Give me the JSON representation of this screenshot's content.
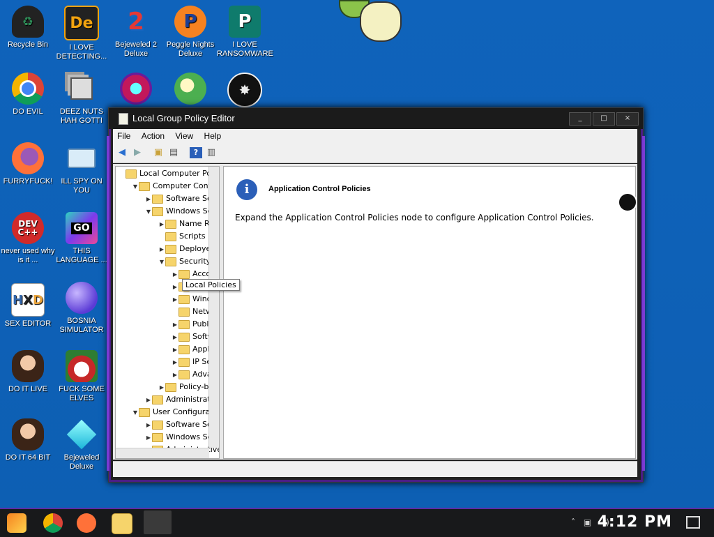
{
  "desktop_icons": [
    {
      "label": "Recycle Bin",
      "icon": "recycle-bin-icon"
    },
    {
      "label": "I LOVE DETECTING...",
      "icon": "detect-it-easy-icon"
    },
    {
      "label": "Bejeweled 2 Deluxe",
      "icon": "bejeweled-2-icon"
    },
    {
      "label": "Peggle Nights Deluxe",
      "icon": "peggle-icon"
    },
    {
      "label": "I LOVE RANSOMWARE",
      "icon": "publisher-icon"
    },
    {
      "label": "DO EVIL",
      "icon": "chrome-icon"
    },
    {
      "label": "DEEZ NUTS HAH GOTTI",
      "icon": "windows-stack-icon"
    },
    {
      "label": "",
      "icon": "gem-icon"
    },
    {
      "label": "",
      "icon": "plants-icon"
    },
    {
      "label": "",
      "icon": "dragon-icon"
    },
    {
      "label": "FURRYFUCK!",
      "icon": "firefox-icon"
    },
    {
      "label": "ILL SPY ON YOU",
      "icon": "spy-icon"
    },
    {
      "label": "never used why is it ...",
      "icon": "devcpp-icon"
    },
    {
      "label": "THIS LANGUAGE ...",
      "icon": "golang-icon"
    },
    {
      "label": "SEX EDITOR",
      "icon": "hxd-icon"
    },
    {
      "label": "BOSNIA SIMULATOR",
      "icon": "mine-icon"
    },
    {
      "label": "DO IT LIVE",
      "icon": "portrait-icon"
    },
    {
      "label": "FUCK SOME ELVES",
      "icon": "santa-icon"
    },
    {
      "label": "DO IT 64 BIT",
      "icon": "portrait-64-icon"
    },
    {
      "label": "Bejeweled Deluxe",
      "icon": "diamond-icon"
    }
  ],
  "window": {
    "title": "Local Group Policy Editor",
    "minimize": "_",
    "maximize": "□",
    "close": "×",
    "menu": [
      "File",
      "Action",
      "View",
      "Help"
    ]
  },
  "tree": [
    {
      "label": "Local Computer Policy",
      "indent": 0,
      "exp": ""
    },
    {
      "label": "Computer Configu",
      "indent": 1,
      "exp": "▼"
    },
    {
      "label": "Software Setti",
      "indent": 2,
      "exp": "▶"
    },
    {
      "label": "Windows Setti",
      "indent": 2,
      "exp": "▼"
    },
    {
      "label": "Name Reso",
      "indent": 3,
      "exp": "▶"
    },
    {
      "label": "Scripts (St",
      "indent": 3,
      "exp": ""
    },
    {
      "label": "Deployed P",
      "indent": 3,
      "exp": "▶"
    },
    {
      "label": "Security S",
      "indent": 3,
      "exp": "▼"
    },
    {
      "label": "Accoun",
      "indent": 4,
      "exp": "▶"
    },
    {
      "label": "",
      "indent": 4,
      "exp": "▶"
    },
    {
      "label": "Windov",
      "indent": 4,
      "exp": "▶"
    },
    {
      "label": "Networ",
      "indent": 4,
      "exp": ""
    },
    {
      "label": "Public I",
      "indent": 4,
      "exp": "▶"
    },
    {
      "label": "Softwa",
      "indent": 4,
      "exp": "▶"
    },
    {
      "label": "Applica",
      "indent": 4,
      "exp": "▶"
    },
    {
      "label": "IP Sec",
      "indent": 4,
      "exp": "▶"
    },
    {
      "label": "Advanc",
      "indent": 4,
      "exp": "▶"
    },
    {
      "label": "Policy-base",
      "indent": 3,
      "exp": "▶"
    },
    {
      "label": "Administrative",
      "indent": 2,
      "exp": "▶"
    },
    {
      "label": "User Configuratio",
      "indent": 1,
      "exp": "▼"
    },
    {
      "label": "Software Setti",
      "indent": 2,
      "exp": "▶"
    },
    {
      "label": "Windows Setti",
      "indent": 2,
      "exp": "▶"
    },
    {
      "label": "Administrative",
      "indent": 2,
      "exp": "▶"
    }
  ],
  "tooltip": "Local Policies",
  "pane": {
    "title": "Application Control Policies",
    "description": "Expand the Application Control Policies node to configure Application Control Policies.",
    "info_glyph": "i"
  },
  "taskbar": {
    "clock": "4:12 PM",
    "apps": [
      "start-icon",
      "chrome-icon",
      "firefox-icon",
      "explorer-icon",
      "group-policy-icon"
    ]
  },
  "colors": {
    "desktop": "#0f62b8",
    "accent": "#7a3bd3",
    "titlebar": "#1b1b1b"
  }
}
